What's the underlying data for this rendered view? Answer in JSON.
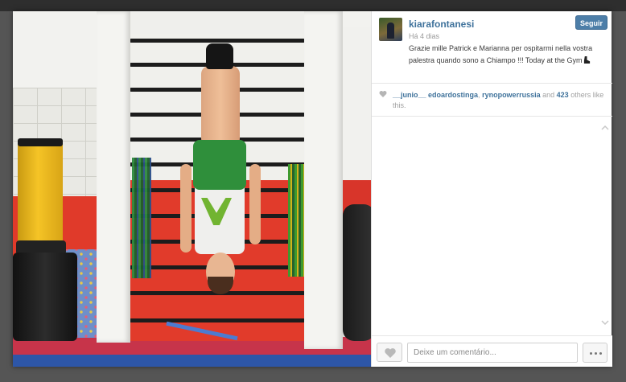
{
  "post": {
    "username": "kiarafontanesi",
    "follow_label": "Seguir",
    "time_ago": "Há 4 dias",
    "caption": "Grazie mille Patrick e Marianna per ospitarmi nella vostra palestra quando sono a Chiampo !!! Today at the Gym",
    "caption_emoji_icon": "boot-icon"
  },
  "likes": {
    "user1": "__junio__",
    "user2": "edoardostinga",
    "user3": "rynopowerrussia",
    "and_label": "and",
    "count": "423",
    "suffix": "others like this.",
    "heart_icon": "heart-icon"
  },
  "comment": {
    "placeholder": "Deixe um comentário...",
    "value": ""
  },
  "colors": {
    "link": "#3f729b",
    "follow_button": "#4d7ea8",
    "backdrop": "#555555"
  },
  "icons": {
    "like_button": "heart-outline-icon",
    "more_button": "ellipsis-icon",
    "scroll_up": "chevron-up-icon",
    "scroll_down": "chevron-down-icon"
  }
}
